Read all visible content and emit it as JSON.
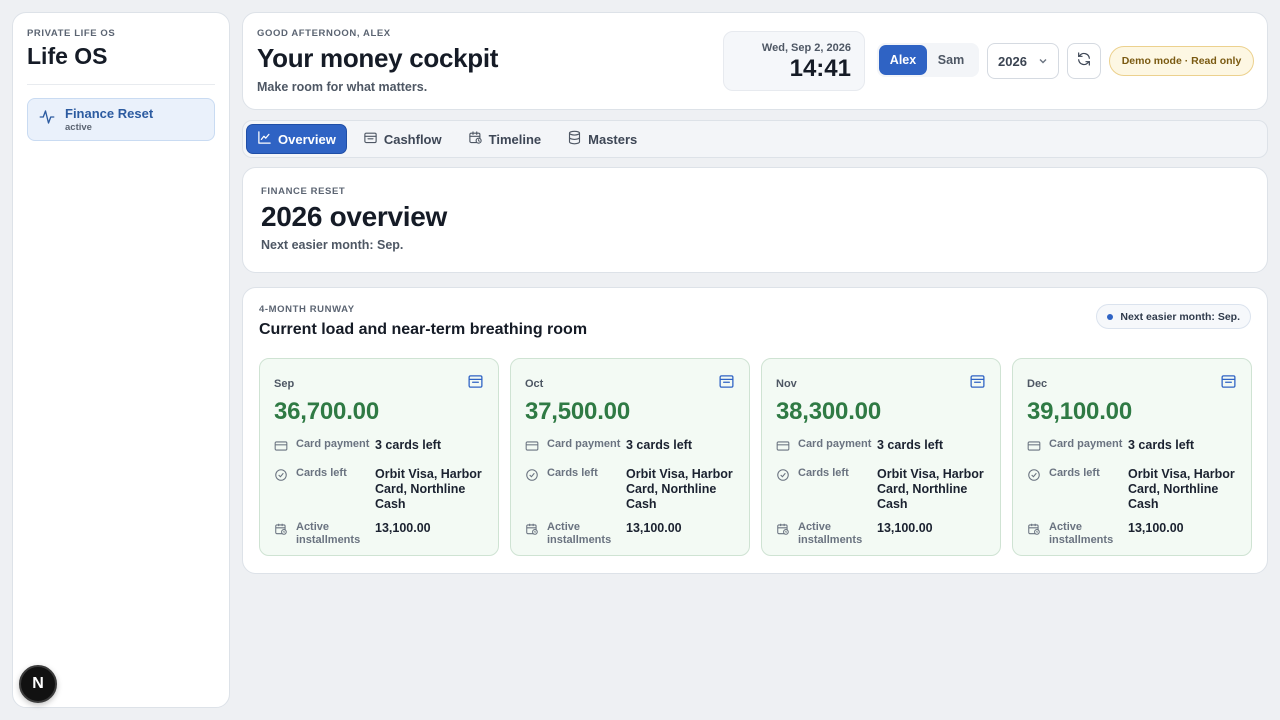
{
  "sidebar": {
    "eyebrow": "PRIVATE LIFE OS",
    "brand": "Life OS",
    "items": [
      {
        "label": "Finance Reset",
        "status": "active",
        "icon": "activity-icon"
      }
    ]
  },
  "header": {
    "greeting": "GOOD AFTERNOON, ALEX",
    "title": "Your money cockpit",
    "subtitle": "Make room for what matters.",
    "date": "Wed, Sep 2, 2026",
    "time": "14:41",
    "users": [
      "Alex",
      "Sam"
    ],
    "active_user": "Alex",
    "year": "2026",
    "demo_badge": "Demo mode · Read only"
  },
  "tabs": [
    {
      "label": "Overview",
      "icon": "chart-line-icon",
      "active": true
    },
    {
      "label": "Cashflow",
      "icon": "wallet-icon",
      "active": false
    },
    {
      "label": "Timeline",
      "icon": "calendar-clock-icon",
      "active": false
    },
    {
      "label": "Masters",
      "icon": "database-icon",
      "active": false
    }
  ],
  "overview": {
    "eyebrow": "FINANCE RESET",
    "title": "2026 overview",
    "subtitle": "Next easier month: Sep."
  },
  "runway": {
    "eyebrow": "4-MONTH RUNWAY",
    "title": "Current load and near-term breathing room",
    "pill": "Next easier month: Sep.",
    "row_labels": {
      "card_payment": "Card payment",
      "cards_left": "Cards left",
      "active_installments": "Active installments"
    },
    "months": [
      {
        "name": "Sep",
        "amount": "36,700.00",
        "card_payment": "3 cards left",
        "cards_left": "Orbit Visa, Harbor Card, Northline Cash",
        "active_installments": "13,100.00"
      },
      {
        "name": "Oct",
        "amount": "37,500.00",
        "card_payment": "3 cards left",
        "cards_left": "Orbit Visa, Harbor Card, Northline Cash",
        "active_installments": "13,100.00"
      },
      {
        "name": "Nov",
        "amount": "38,300.00",
        "card_payment": "3 cards left",
        "cards_left": "Orbit Visa, Harbor Card, Northline Cash",
        "active_installments": "13,100.00"
      },
      {
        "name": "Dec",
        "amount": "39,100.00",
        "card_payment": "3 cards left",
        "cards_left": "Orbit Visa, Harbor Card, Northline Cash",
        "active_installments": "13,100.00"
      }
    ]
  },
  "dev_badge": "N",
  "colors": {
    "accent": "#2f63c4",
    "positive": "#2f7a44",
    "card_bg": "#f3faf4",
    "demo_bg": "#fdf7e3"
  }
}
